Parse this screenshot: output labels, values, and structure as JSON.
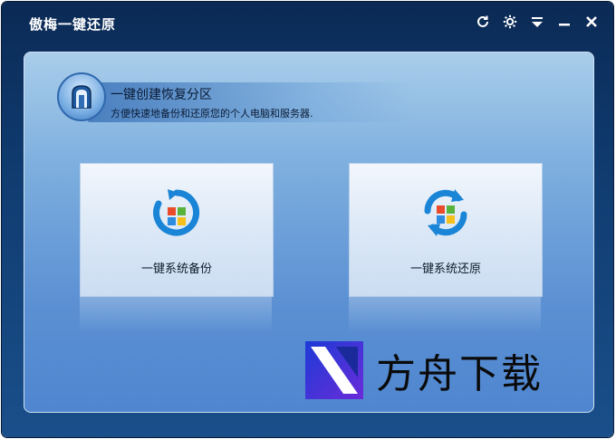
{
  "window": {
    "title": "傲梅一键还原",
    "controls": {
      "refresh_icon": "refresh-icon",
      "settings_icon": "gear-icon",
      "menu_icon": "menu-icon",
      "minimize_icon": "minimize-icon",
      "close_icon": "close-icon"
    }
  },
  "banner": {
    "title": "一键创建恢复分区",
    "subtitle": "方便快速地备份和还原您的个人电脑和服务器."
  },
  "actions": [
    {
      "label": "一键系统备份",
      "icon": "backup-icon"
    },
    {
      "label": "一键系统还原",
      "icon": "restore-icon"
    }
  ],
  "watermark": {
    "text": "方舟下载"
  },
  "colors": {
    "frame": "#0f3a6e",
    "panel_top": "#a9cdea",
    "panel_bottom": "#4f86cf",
    "tile": "#e4eef9"
  }
}
